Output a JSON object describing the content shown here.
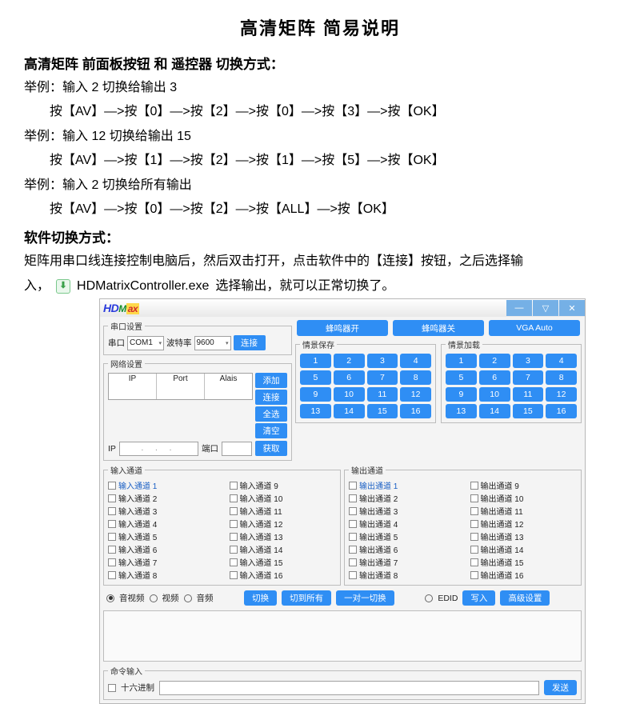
{
  "doc": {
    "title": "高清矩阵  简易说明",
    "sec1_title": "高清矩阵 前面板按钮 和 遥控器 切换方式：",
    "ex1_a": "举例：输入 2 切换给输出 3",
    "ex1_b": "按【AV】—>按【0】—>按【2】—>按【0】—>按【3】—>按【OK】",
    "ex2_a": "举例：输入 12 切换给输出 15",
    "ex2_b": "按【AV】—>按【1】—>按【2】—>按【1】—>按【5】—>按【OK】",
    "ex3_a": "举例：输入 2 切换给所有输出",
    "ex3_b": "按【AV】—>按【0】—>按【2】—>按【ALL】—>按【OK】",
    "sec2_title": "软件切换方式：",
    "sw_a": "矩阵用串口线连接控制电脑后，然后双击打开，点击软件中的【连接】按钮，之后选择输",
    "sw_b_pre": "入，",
    "exe_name": "HDMatrixController.exe",
    "sw_b_post": "选择输出，就可以正常切换了。"
  },
  "app": {
    "logo_hd": "HD",
    "logo_m": "M",
    "logo_ax": "ax",
    "win_min": "—",
    "win_restore": "▽",
    "win_close": "✕",
    "serial_legend": "串口设置",
    "lbl_port": "串口",
    "combo_port": "COM1",
    "lbl_baud": "波特率",
    "combo_baud": "9600",
    "btn_connect": "连接",
    "net_legend": "网络设置",
    "col_ip": "IP",
    "col_port": "Port",
    "col_alias": "Alais",
    "btn_add": "添加",
    "btn_link": "连接",
    "btn_all": "全选",
    "btn_clear": "清空",
    "lbl_ip": "IP",
    "ip_placeholder": ". . .",
    "lbl_port2": "端口",
    "btn_get": "获取",
    "btn_buzz_on": "蜂鸣器开",
    "btn_buzz_off": "蜂鸣器关",
    "btn_vga": "VGA Auto",
    "scene_save": "情景保存",
    "scene_load": "情景加载",
    "nums": [
      "1",
      "2",
      "3",
      "4",
      "5",
      "6",
      "7",
      "8",
      "9",
      "10",
      "11",
      "12",
      "13",
      "14",
      "15",
      "16"
    ],
    "in_legend": "输入通道",
    "out_legend": "输出通道",
    "in_prefix": "输入通道 ",
    "out_prefix": "输出通道 ",
    "ch_nums": [
      "1",
      "2",
      "3",
      "4",
      "5",
      "6",
      "7",
      "8",
      "9",
      "10",
      "11",
      "12",
      "13",
      "14",
      "15",
      "16"
    ],
    "r_av": "音视频",
    "r_v": "视频",
    "r_a": "音频",
    "btn_switch": "切换",
    "btn_switch_all": "切到所有",
    "btn_one2one": "一对一切换",
    "lbl_edid": "EDID",
    "btn_write": "写入",
    "btn_adv": "高级设置",
    "cmd_legend": "命令输入",
    "chk_hex": "十六进制",
    "btn_send": "发送"
  }
}
